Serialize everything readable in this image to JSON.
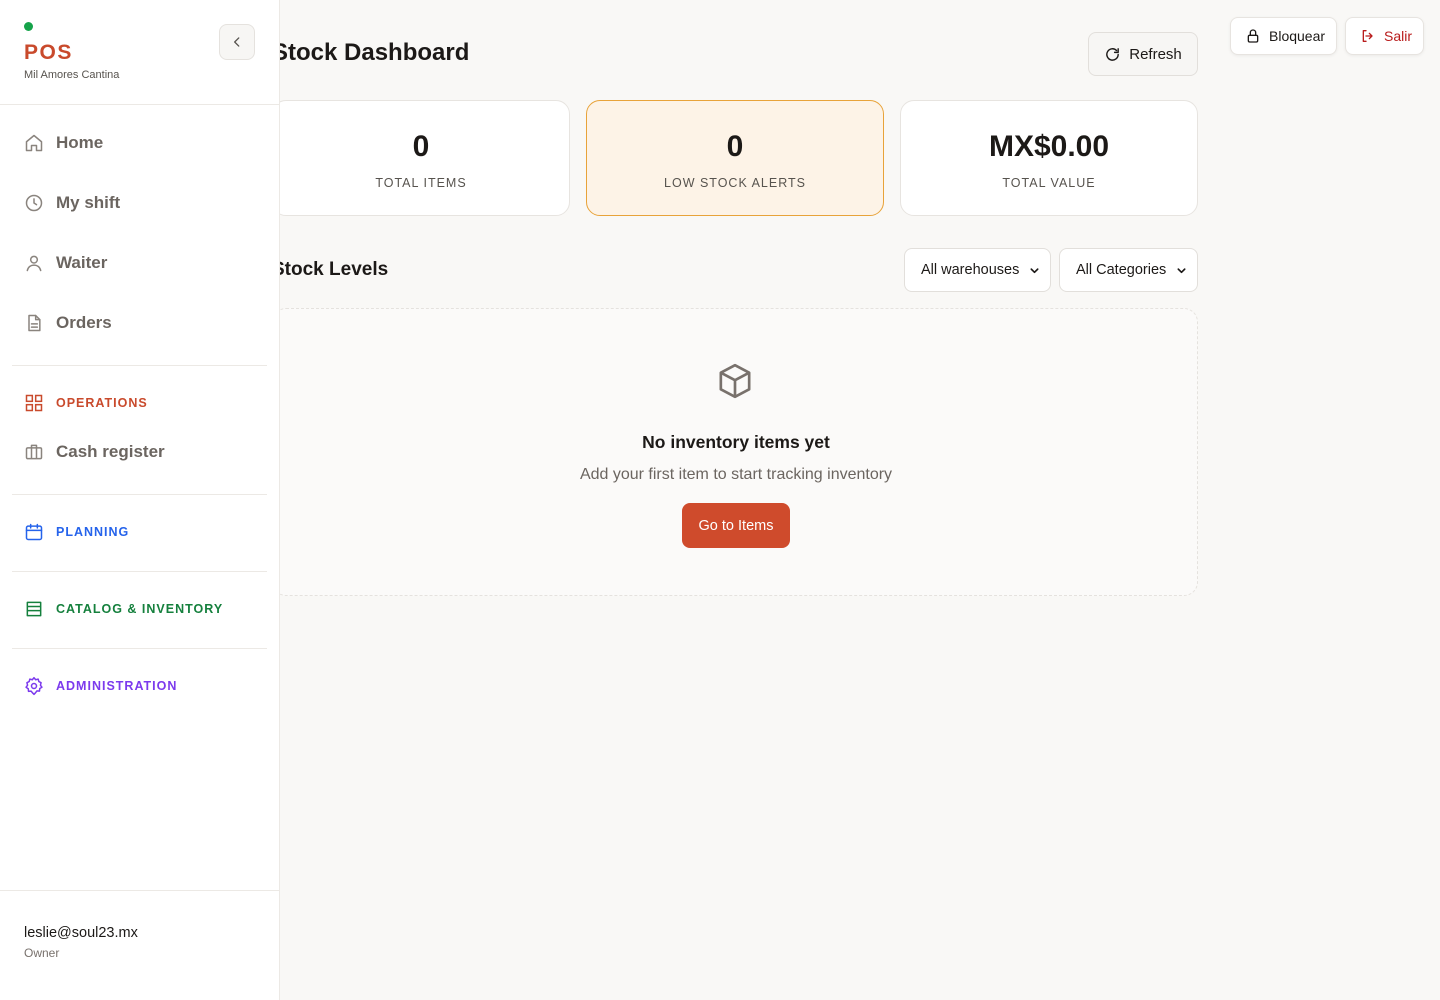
{
  "brand": {
    "title": "POS",
    "subtitle": "Mil Amores Cantina",
    "status_color": "#16a34a",
    "accent": "#c94a2c"
  },
  "sidebar": {
    "items": [
      {
        "label": "Home",
        "icon": "home-icon"
      },
      {
        "label": "My shift",
        "icon": "clock-icon"
      },
      {
        "label": "Waiter",
        "icon": "user-icon"
      },
      {
        "label": "Orders",
        "icon": "document-icon"
      }
    ],
    "sections": [
      {
        "label": "OPERATIONS",
        "icon": "grid-icon",
        "color": "#c94a2c"
      },
      {
        "label": "PLANNING",
        "icon": "calendar-icon",
        "color": "#2563eb"
      },
      {
        "label": "CATALOG & INVENTORY",
        "icon": "catalog-icon",
        "color": "#15803d"
      },
      {
        "label": "ADMINISTRATION",
        "icon": "gear-icon",
        "color": "#7c3aed"
      }
    ],
    "operations_items": [
      {
        "label": "Cash register",
        "icon": "briefcase-icon"
      }
    ]
  },
  "user": {
    "email": "leslie@soul23.mx",
    "role": "Owner"
  },
  "topbar": {
    "lock_label": "Bloquear",
    "logout_label": "Salir"
  },
  "page": {
    "title": "Stock Dashboard",
    "refresh_label": "Refresh"
  },
  "stats": [
    {
      "value": "0",
      "label": "TOTAL ITEMS"
    },
    {
      "value": "0",
      "label": "LOW STOCK ALERTS"
    },
    {
      "value": "MX$0.00",
      "label": "TOTAL VALUE"
    }
  ],
  "stock_levels": {
    "title": "Stock Levels",
    "warehouse_filter": "All warehouses",
    "category_filter": "All Categories",
    "empty": {
      "title": "No inventory items yet",
      "subtitle": "Add your first item to start tracking inventory",
      "button": "Go to Items"
    }
  }
}
